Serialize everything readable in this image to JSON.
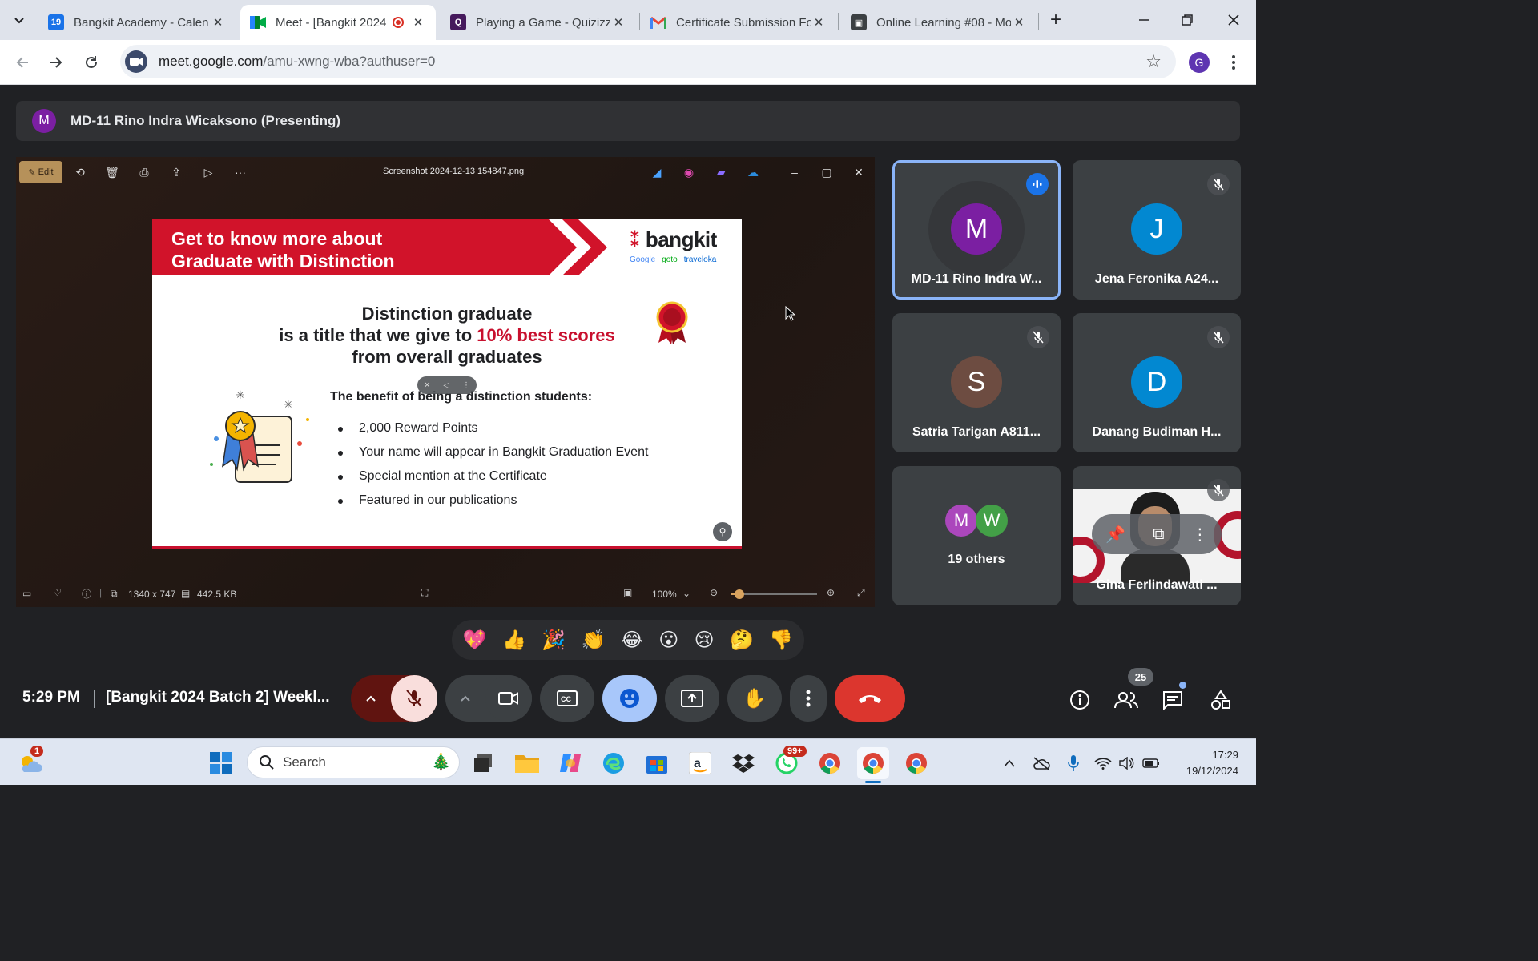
{
  "browser": {
    "tabs": [
      {
        "title": "Bangkit Academy - Calen",
        "favicon": "calendar-icon",
        "color": "#1a73e8"
      },
      {
        "title": "Meet - [Bangkit 2024",
        "favicon": "meet-icon",
        "color": "#00832d",
        "active": true
      },
      {
        "title": "Playing a Game - Quizizz",
        "favicon": "quizizz-icon",
        "color": "#461a5c"
      },
      {
        "title": "Certificate Submission Fo",
        "favicon": "gmail-icon",
        "color": "#ea4335"
      },
      {
        "title": "Online Learning #08 - Mo",
        "favicon": "classroom-icon",
        "color": "#3c4043"
      }
    ],
    "new_tab": "+",
    "url_host": "meet.google.com",
    "url_path": "/amu-xwng-wba?authuser=0",
    "profile_initial": "G"
  },
  "presenter": {
    "initial": "M",
    "label": "MD-11 Rino Indra Wicaksono (Presenting)"
  },
  "viewer": {
    "edit_label": "Edit",
    "filename": "Screenshot 2024-12-13 154847.png",
    "dimensions": "1340 x 747",
    "filesize": "442.5 KB",
    "zoom": "100%",
    "zoom_level": 0.1
  },
  "slide": {
    "title_line1": "Get to know more about",
    "title_line2": "Graduate with Distinction",
    "brand": "bangkit",
    "partners": [
      "Google",
      "goto",
      "traveloka"
    ],
    "main_line1": "Distinction graduate",
    "main_line2a": "is a title that we give to ",
    "main_line2b": "10% best scores",
    "main_line3": "from overall graduates",
    "benefit_heading": "The benefit of being a distinction students:",
    "benefits": [
      "2,000 Reward Points",
      "Your name will appear in Bangkit Graduation Event",
      "Special mention at the Certificate",
      "Featured in our publications"
    ],
    "accent_color": "#c8102e"
  },
  "participants": [
    {
      "initial": "M",
      "name": "MD-11 Rino Indra W...",
      "color": "#7b1fa2",
      "speaking": true
    },
    {
      "initial": "J",
      "name": "Jena Feronika A24...",
      "color": "#0288d1",
      "muted": true
    },
    {
      "initial": "S",
      "name": "Satria Tarigan A811...",
      "color": "#6d4c41",
      "muted": true
    },
    {
      "initial": "D",
      "name": "Danang Budiman H...",
      "color": "#0288d1",
      "muted": true
    },
    {
      "name": "19 others",
      "stack": [
        "M",
        "W"
      ],
      "stack_colors": [
        "#ab47bc",
        "#43a047"
      ]
    },
    {
      "name": "Gina Ferlindawati ...",
      "video": true,
      "muted": true
    }
  ],
  "reactions": [
    "💖",
    "👍",
    "🎉",
    "👏",
    "😂",
    "😮",
    "😢",
    "🤔",
    "👎"
  ],
  "meeting": {
    "time": "5:29 PM",
    "title": "[Bangkit 2024 Batch 2] Weekl...",
    "participant_count": "25"
  },
  "taskbar": {
    "search_placeholder": "Search",
    "weather_badge": "1",
    "whatsapp_badge": "99+",
    "time": "17:29",
    "date": "19/12/2024"
  }
}
